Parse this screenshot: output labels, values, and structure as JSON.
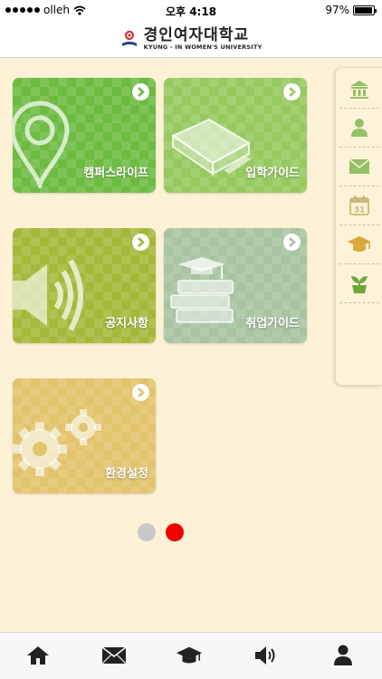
{
  "status_bar": {
    "carrier": "olleh",
    "time": "오후 4:18",
    "battery": "97%",
    "battery_level": 0.97
  },
  "header": {
    "logo_korean": "경인여자대학교",
    "logo_english": "KYUNG - IN WOMEN'S UNIVERSITY"
  },
  "tiles": [
    {
      "label": "캠퍼스라이프",
      "icon": "map-pin-icon",
      "color": "#6dbc42"
    },
    {
      "label": "입학가이드",
      "icon": "book-pen-icon",
      "color": "#96c95f"
    },
    {
      "label": "공지사항",
      "icon": "speaker-icon",
      "color": "#a5b83a"
    },
    {
      "label": "취업가이드",
      "icon": "books-graduation-cap-icon",
      "color": "#a8c4a2"
    },
    {
      "label": "환경설정",
      "icon": "gears-icon",
      "color": "#e2c46c"
    }
  ],
  "pager": {
    "page_count": 2,
    "current_page": 2,
    "active_color": "#f50000",
    "inactive_color": "#c8c8c8"
  },
  "side_menu": [
    "university-building-icon",
    "person-icon",
    "mail-icon",
    "calendar-31-icon",
    "graduation-cap-icon",
    "plant-pot-icon"
  ],
  "side_menu_calendar_day": "31",
  "tab_bar": [
    "home-icon",
    "mail-icon",
    "graduation-cap-icon",
    "speaker-icon",
    "person-icon"
  ]
}
